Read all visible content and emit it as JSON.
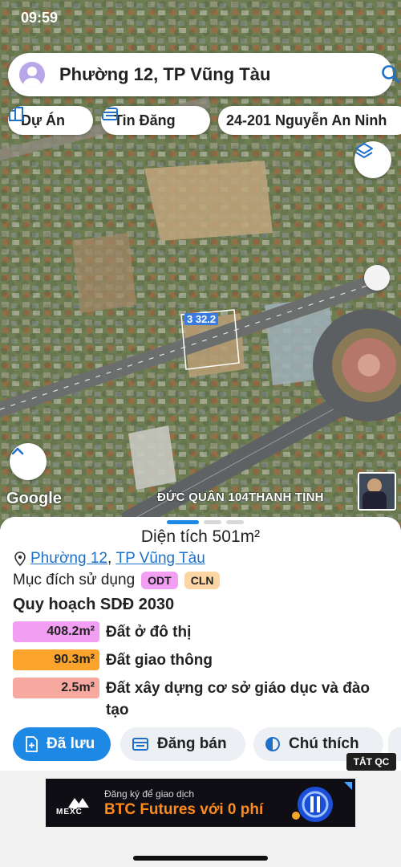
{
  "status": {
    "time": "09:59"
  },
  "search": {
    "title": "Phường 12, TP Vũng Tàu"
  },
  "chips": {
    "du_an": "Dự Án",
    "tin_dang": "Tin Đăng",
    "address": "24-201 Nguyễn An Ninh"
  },
  "map": {
    "parcel_label": "3 32.2",
    "google": "Google",
    "caption": "ĐỨC QUÂN 104THANH TỊNH"
  },
  "sheet": {
    "area": "Diện tích 501m²",
    "location": {
      "ward": "Phường 12",
      "separator": ", ",
      "city": "TP Vũng Tàu"
    },
    "purpose_label": "Mục đích sử dụng",
    "purpose_badges": [
      "ODT",
      "CLN"
    ],
    "plan_title": "Quy hoạch SDĐ 2030",
    "plan_rows": [
      {
        "value": "408.2m²",
        "label": "Đất ở đô thị",
        "color": "#f29ef2"
      },
      {
        "value": "90.3m²",
        "label": "Đất giao thông",
        "color": "#fba32a"
      },
      {
        "value": "2.5m²",
        "label": "Đất xây dựng cơ sở giáo dục và đào tạo",
        "color": "#f7a9a0"
      }
    ],
    "actions": {
      "saved": "Đã lưu",
      "sell": "Đăng bán",
      "legend": "Chú thích"
    }
  },
  "hide_ads": "TẮT QC",
  "ad": {
    "brand": "MEXC",
    "small_text": "Đăng ký để giao dịch",
    "big_text": "BTC Futures với 0 phí"
  },
  "colors": {
    "accent": "#1e88e5",
    "link": "#1e70c8"
  }
}
